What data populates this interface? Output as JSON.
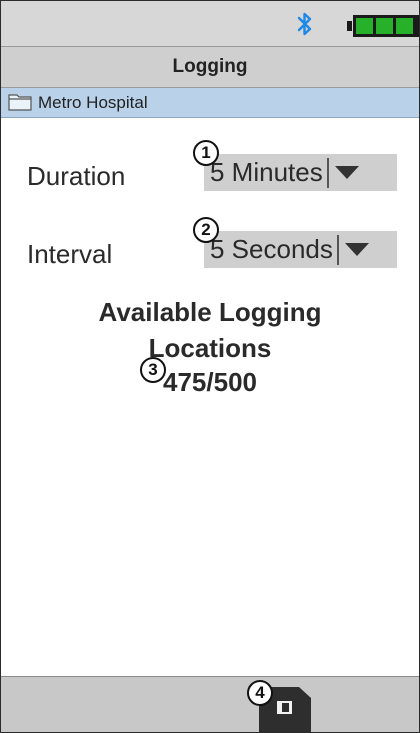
{
  "status_bar": {
    "bluetooth_icon": "bluetooth-icon",
    "battery_icon": "battery-icon",
    "battery_level": 1.0,
    "bluetooth_color": "#1e88e5",
    "battery_color": "#27b02a"
  },
  "header": {
    "title": "Logging"
  },
  "location": {
    "icon": "folder-icon",
    "name": "Metro Hospital"
  },
  "settings": {
    "duration": {
      "label": "Duration",
      "value": "5 Minutes",
      "callout": "1"
    },
    "interval": {
      "label": "Interval",
      "value": "5 Seconds",
      "callout": "2"
    }
  },
  "info": {
    "line1": "Available Logging",
    "line2": "Locations",
    "count": "475/500",
    "callout": "3"
  },
  "footer": {
    "save_icon": "save-icon",
    "callout": "4"
  }
}
